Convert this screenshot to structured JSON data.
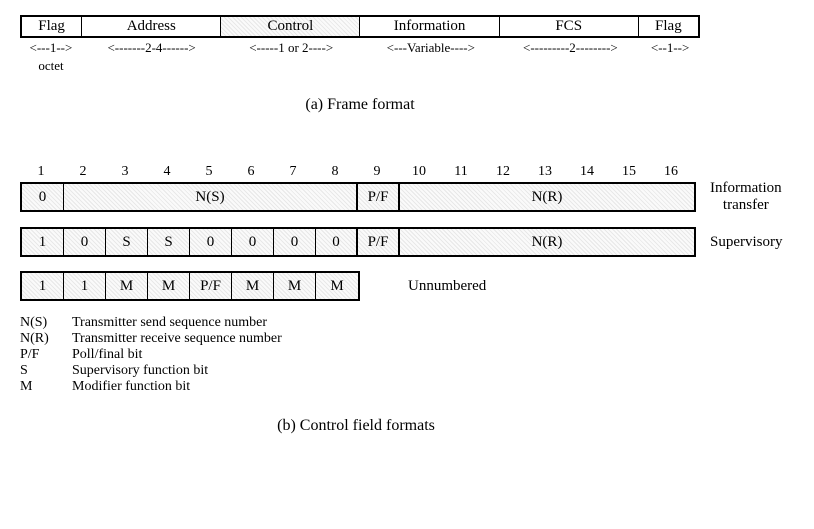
{
  "frame": {
    "cells": [
      "Flag",
      "Address",
      "Control",
      "Information",
      "FCS",
      "Flag"
    ],
    "widths": [
      "<---1-->",
      "<-------2-4------>",
      "<-----1 or 2---->",
      "<---Variable---->",
      "<---------2-------->",
      "<--1-->"
    ],
    "octet": "octet",
    "caption": "(a) Frame format"
  },
  "control": {
    "bits": [
      "1",
      "2",
      "3",
      "4",
      "5",
      "6",
      "7",
      "8",
      "9",
      "10",
      "11",
      "12",
      "13",
      "14",
      "15",
      "16"
    ],
    "info": {
      "b1": "0",
      "ns": "N(S)",
      "pf": "P/F",
      "nr": "N(R)",
      "label1": "Information",
      "label2": "transfer"
    },
    "sup": {
      "b1": "1",
      "b2": "0",
      "s": "S",
      "z": "0",
      "pf": "P/F",
      "nr": "N(R)",
      "label": "Supervisory"
    },
    "unn": {
      "b1": "1",
      "b2": "1",
      "m": "M",
      "pf": "P/F",
      "label": "Unnumbered"
    },
    "legend": {
      "ns": {
        "k": "N(S)",
        "d": "Transmitter send sequence number"
      },
      "nr": {
        "k": "N(R)",
        "d": "Transmitter receive sequence number"
      },
      "pf": {
        "k": "P/F",
        "d": "Poll/final bit"
      },
      "s": {
        "k": "S",
        "d": "Supervisory function bit"
      },
      "m": {
        "k": "M",
        "d": "Modifier function bit"
      }
    },
    "caption": "(b) Control field formats"
  }
}
